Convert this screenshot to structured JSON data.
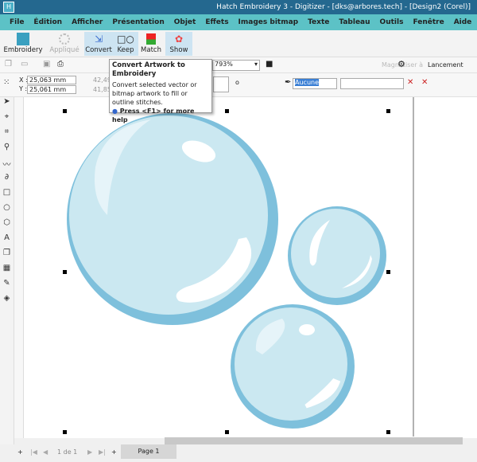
{
  "title": "Hatch Embroidery 3 - Digitizer - [dks@arbores.tech] - [Design2 (Corel)]",
  "menu": [
    "File",
    "Édition",
    "Afficher",
    "Présentation",
    "Objet",
    "Effets",
    "Images bitmap",
    "Texte",
    "Tableau",
    "Outils",
    "Fenêtre",
    "Aide"
  ],
  "ribbon": {
    "embroidery": "Embroidery",
    "applique": "Appliqué",
    "convert": "Convert",
    "keep": "Keep",
    "match": "Match",
    "show": "Show"
  },
  "toolbar": {
    "zoom": "793%",
    "snap": "Magnétiser à",
    "launch": "Lancement"
  },
  "props": {
    "x_label": "X :",
    "x": "25,063 mm",
    "y_label": "Y :",
    "y": "25,061 mm",
    "w": "42,493",
    "h": "41,85",
    "degree": "o",
    "outline": "Aucune"
  },
  "tooltip": {
    "title": "Convert Artwork to Embroidery",
    "body": "Convert selected vector or bitmap artwork to fill or outline stitches.",
    "help": "Press <F1> for more help"
  },
  "pages": {
    "counter": "1 de 1",
    "tab": "Page 1"
  },
  "colors": {
    "titlebar": "#24688f",
    "menubar": "#5cc2c6",
    "bubble_ring": "#7ec0dc",
    "bubble_fill": "#cbe8f1"
  }
}
